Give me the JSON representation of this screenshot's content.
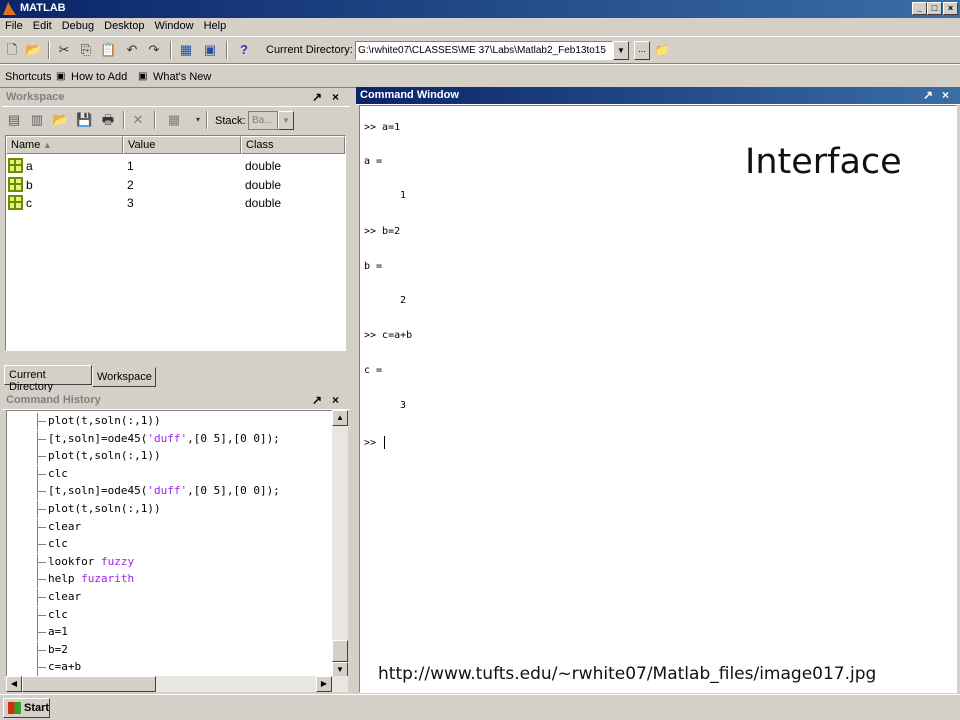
{
  "window": {
    "title": "MATLAB"
  },
  "menu": [
    "File",
    "Edit",
    "Debug",
    "Desktop",
    "Window",
    "Help"
  ],
  "toolbar": {
    "icons": [
      "new-file-icon",
      "open-file-icon",
      "cut-icon",
      "copy-icon",
      "paste-icon",
      "undo-icon",
      "redo-icon",
      "simulink-icon",
      "guide-icon",
      "help-icon"
    ],
    "current_directory_label": "Current Directory:",
    "current_directory_value": "G:\\rwhite07\\CLASSES\\ME 37\\Labs\\Matlab2_Feb13to15",
    "browse_label": "..."
  },
  "shortcuts": {
    "label": "Shortcuts",
    "items": [
      "How to Add",
      "What's New"
    ]
  },
  "workspace": {
    "title": "Workspace",
    "stack_label": "Stack:",
    "stack_value": "Ba...",
    "columns": [
      "Name",
      "Value",
      "Class"
    ],
    "rows": [
      {
        "name": "a",
        "value": "1",
        "class": "double"
      },
      {
        "name": "b",
        "value": "2",
        "class": "double"
      },
      {
        "name": "c",
        "value": "3",
        "class": "double"
      }
    ],
    "tabs": [
      "Current Directory",
      "Workspace"
    ]
  },
  "history": {
    "title": "Command History",
    "lines": [
      [
        "plot(t,soln(:,1))"
      ],
      [
        "[t,soln]=ode45(",
        "'duff'",
        ",[0 5],[0 0]);"
      ],
      [
        "plot(t,soln(:,1))"
      ],
      [
        "clc"
      ],
      [
        "[t,soln]=ode45(",
        "'duff'",
        ",[0 5],[0 0]);"
      ],
      [
        "plot(t,soln(:,1))"
      ],
      [
        "clear"
      ],
      [
        "clc"
      ],
      [
        "lookfor ",
        "fuzzy",
        ""
      ],
      [
        "help ",
        "fuzarith",
        ""
      ],
      [
        "clear"
      ],
      [
        "clc"
      ],
      [
        "a=1"
      ],
      [
        "b=2"
      ],
      [
        "c=a+b"
      ]
    ]
  },
  "command_window": {
    "title": "Command Window",
    "lines": [
      ">> a=1",
      "a =",
      "1",
      ">> b=2",
      "b =",
      "2",
      ">> c=a+b",
      "c =",
      "3",
      ">> "
    ]
  },
  "overlay": {
    "title": "Interface",
    "url": "http://www.tufts.edu/~rwhite07/Matlab_files/image017.jpg"
  },
  "taskbar": {
    "start_label": "Start"
  }
}
